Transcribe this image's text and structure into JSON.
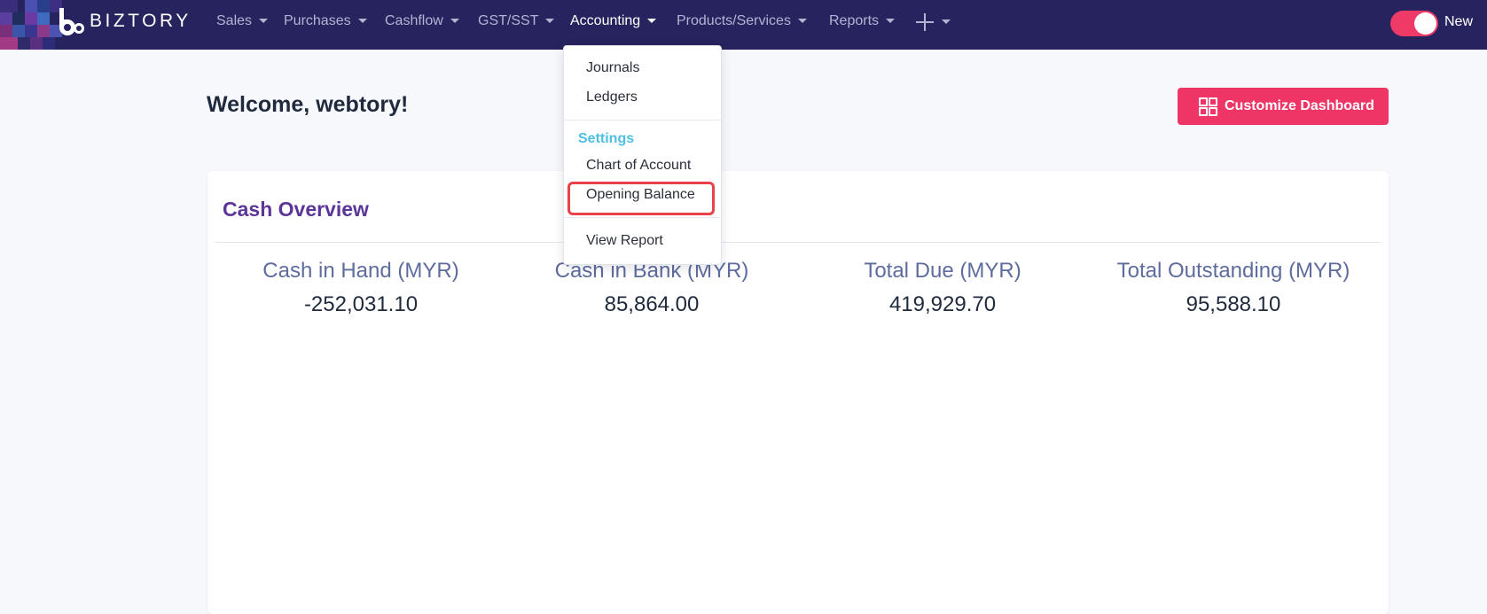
{
  "brand": {
    "name": "BIZTORY"
  },
  "nav": {
    "items": [
      {
        "label": "Sales"
      },
      {
        "label": "Purchases"
      },
      {
        "label": "Cashflow"
      },
      {
        "label": "GST/SST"
      },
      {
        "label": "Accounting",
        "active": true
      },
      {
        "label": "Products/Services"
      },
      {
        "label": "Reports"
      }
    ],
    "add_icon": "plus-icon",
    "toggle": {
      "label": "New",
      "on": true
    }
  },
  "accounting_menu": {
    "items": [
      {
        "label": "Journals"
      },
      {
        "label": "Ledgers"
      }
    ],
    "settings_header": "Settings",
    "settings_items": [
      {
        "label": "Chart of Account"
      },
      {
        "label": "Opening Balance",
        "highlighted": true
      }
    ],
    "report_item": {
      "label": "View Report"
    }
  },
  "page": {
    "welcome": "Welcome, webtory!",
    "customize_button": "Customize Dashboard"
  },
  "cash_overview": {
    "title": "Cash Overview",
    "stats": [
      {
        "label": "Cash in Hand (MYR)",
        "value": "-252,031.10"
      },
      {
        "label": "Cash in Bank (MYR)",
        "value": "85,864.00"
      },
      {
        "label": "Total Due (MYR)",
        "value": "419,929.70"
      },
      {
        "label": "Total Outstanding (MYR)",
        "value": "95,588.10"
      }
    ]
  },
  "colors": {
    "navbar": "#27235e",
    "accent": "#ee3566",
    "title_purple": "#5b3598",
    "settings_blue": "#4ec0e3",
    "highlight_red": "#e8434b"
  }
}
